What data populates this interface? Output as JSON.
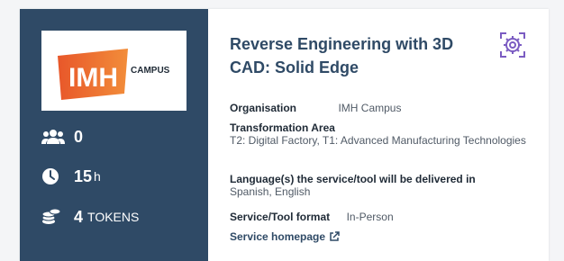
{
  "logo": {
    "text": "IMH",
    "caption": "CAMPUS"
  },
  "stats": {
    "participants": "0",
    "duration_value": "15",
    "duration_unit": "h",
    "tokens_value": "4",
    "tokens_label": "TOKENS"
  },
  "card": {
    "title": "Reverse Engineering with 3D CAD: Solid Edge",
    "organisation_label": "Organisation",
    "organisation_value": "IMH Campus",
    "transformation_label": "Transformation Area",
    "transformation_value": "T2: Digital Factory, T1: Advanced Manufacturing Technologies",
    "language_label": "Language(s) the service/tool will be delivered in",
    "language_value": "Spanish, English",
    "format_label": "Service/Tool format",
    "format_value": "In-Person",
    "homepage_link": "Service homepage"
  },
  "colors": {
    "panel": "#2f4a66",
    "gear_accent": "#7b5cc2",
    "logo_orange": "#e8572a"
  },
  "icons": [
    "group-icon",
    "clock-icon",
    "coins-icon",
    "gear-icon",
    "external-link-icon"
  ]
}
